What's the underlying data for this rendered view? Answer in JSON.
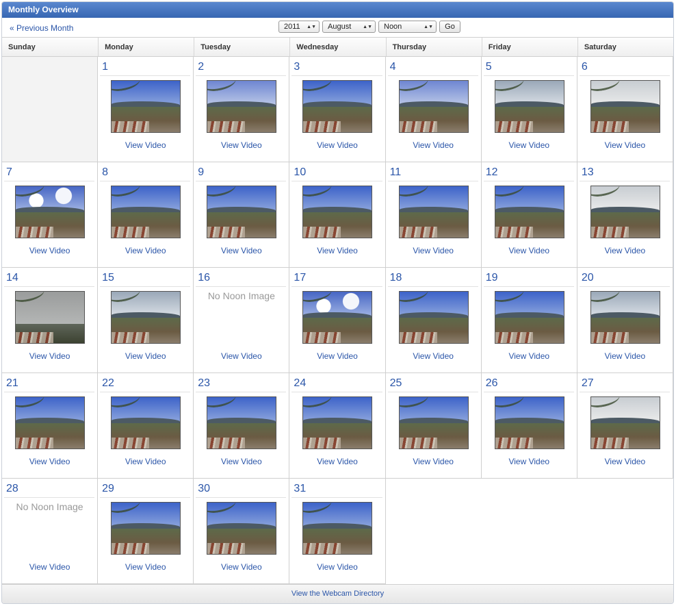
{
  "panel": {
    "title": "Monthly Overview"
  },
  "toolbar": {
    "previous_label": "« Previous Month",
    "year": "2011",
    "month": "August",
    "time": "Noon",
    "go_label": "Go"
  },
  "weekdays": [
    "Sunday",
    "Monday",
    "Tuesday",
    "Wednesday",
    "Thursday",
    "Friday",
    "Saturday"
  ],
  "video_label": "View Video",
  "no_image_label": "No Noon Image",
  "footer": {
    "directory_label": "View the Webcam Directory"
  },
  "colors": {
    "link": "#2a55a8",
    "header_bar": "#3766b2"
  },
  "weeks": [
    [
      {
        "day": null
      },
      {
        "day": "1",
        "sky": "blue"
      },
      {
        "day": "2",
        "sky": "lightblue"
      },
      {
        "day": "3",
        "sky": "blue"
      },
      {
        "day": "4",
        "sky": "lightblue"
      },
      {
        "day": "5",
        "sky": "cloudy"
      },
      {
        "day": "6",
        "sky": "overcast"
      }
    ],
    [
      {
        "day": "7",
        "sky": "clouds"
      },
      {
        "day": "8",
        "sky": "blue"
      },
      {
        "day": "9",
        "sky": "blue"
      },
      {
        "day": "10",
        "sky": "blue"
      },
      {
        "day": "11",
        "sky": "blue"
      },
      {
        "day": "12",
        "sky": "blue"
      },
      {
        "day": "13",
        "sky": "overcast"
      }
    ],
    [
      {
        "day": "14",
        "sky": "foggy"
      },
      {
        "day": "15",
        "sky": "cloudy"
      },
      {
        "day": "16",
        "sky": null
      },
      {
        "day": "17",
        "sky": "clouds"
      },
      {
        "day": "18",
        "sky": "blue"
      },
      {
        "day": "19",
        "sky": "blue"
      },
      {
        "day": "20",
        "sky": "cloudy"
      }
    ],
    [
      {
        "day": "21",
        "sky": "blue"
      },
      {
        "day": "22",
        "sky": "blue"
      },
      {
        "day": "23",
        "sky": "blue"
      },
      {
        "day": "24",
        "sky": "blue"
      },
      {
        "day": "25",
        "sky": "blue"
      },
      {
        "day": "26",
        "sky": "blue"
      },
      {
        "day": "27",
        "sky": "overcast"
      }
    ],
    [
      {
        "day": "28",
        "sky": null
      },
      {
        "day": "29",
        "sky": "blue"
      },
      {
        "day": "30",
        "sky": "blue"
      },
      {
        "day": "31",
        "sky": "blue"
      },
      {
        "blank": true
      },
      {
        "blank": true
      },
      {
        "blank": true
      }
    ]
  ]
}
